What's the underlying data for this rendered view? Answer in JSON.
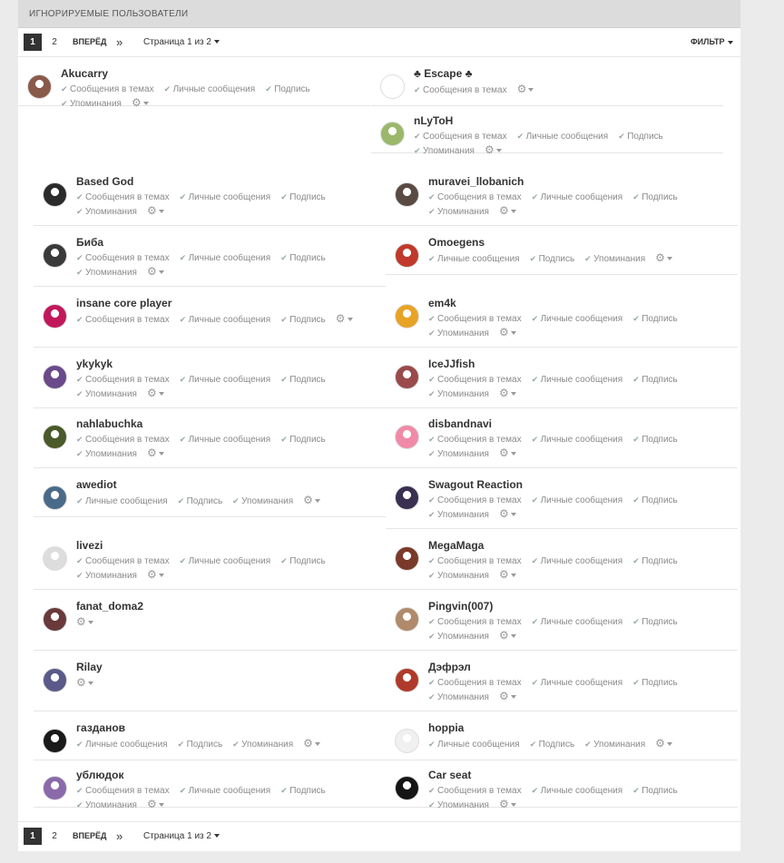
{
  "header": {
    "title": "ИГНОРИРУЕМЫЕ ПОЛЬЗОВАТЕЛИ"
  },
  "pagination": {
    "pages": [
      "1",
      "2"
    ],
    "next_label": "ВПЕРЁД",
    "last_icon": "»",
    "page_info": "Страница 1 из 2",
    "filter_label": "ФИЛЬТР"
  },
  "option_labels": {
    "topics": "Сообщения в темах",
    "pm": "Личные сообщения",
    "sig": "Подпись",
    "mentions": "Упоминания"
  },
  "users": [
    {
      "name": "Akucarry",
      "options": [
        "topics",
        "pm",
        "sig",
        "mentions"
      ],
      "avatar_color": "#8a5a4a"
    },
    {
      "name": "♣ Escape ♣",
      "options": [
        "topics"
      ],
      "avatar_color": "#ffffff"
    },
    {
      "name": "nLyToH",
      "options": [
        "topics",
        "pm",
        "sig",
        "mentions"
      ],
      "avatar_color": "#9bb86a"
    },
    {
      "name": "Based God",
      "options": [
        "topics",
        "pm",
        "sig",
        "mentions"
      ],
      "avatar_color": "#2b2b2b"
    },
    {
      "name": "muravei_llobanich",
      "options": [
        "topics",
        "pm",
        "sig",
        "mentions"
      ],
      "avatar_color": "#5a4a44"
    },
    {
      "name": "Биба",
      "options": [
        "topics",
        "pm",
        "sig",
        "mentions"
      ],
      "avatar_color": "#3a3a3a"
    },
    {
      "name": "Omoegens",
      "options": [
        "pm",
        "sig",
        "mentions"
      ],
      "avatar_color": "#c0392b"
    },
    {
      "name": "insane core player",
      "options": [
        "topics",
        "pm",
        "sig"
      ],
      "avatar_color": "#c2185b"
    },
    {
      "name": "em4k",
      "options": [
        "topics",
        "pm",
        "sig",
        "mentions"
      ],
      "avatar_color": "#e8a325"
    },
    {
      "name": "ykykyk",
      "options": [
        "topics",
        "pm",
        "sig",
        "mentions"
      ],
      "avatar_color": "#6a4a8a"
    },
    {
      "name": "IceJJfish",
      "options": [
        "topics",
        "pm",
        "sig",
        "mentions"
      ],
      "avatar_color": "#9a4a4a"
    },
    {
      "name": "nahlabuchka",
      "options": [
        "topics",
        "pm",
        "sig",
        "mentions"
      ],
      "avatar_color": "#4a5a2a"
    },
    {
      "name": "disbandnavi",
      "options": [
        "topics",
        "pm",
        "sig",
        "mentions"
      ],
      "avatar_color": "#f08aa8"
    },
    {
      "name": "awediot",
      "options": [
        "pm",
        "sig",
        "mentions"
      ],
      "avatar_color": "#4a6a8a"
    },
    {
      "name": "Swagout Reaction",
      "options": [
        "topics",
        "pm",
        "sig",
        "mentions"
      ],
      "avatar_color": "#3a3050"
    },
    {
      "name": "livezi",
      "options": [
        "topics",
        "pm",
        "sig",
        "mentions"
      ],
      "avatar_color": "#dddddd"
    },
    {
      "name": "MegaMaga",
      "options": [
        "topics",
        "pm",
        "sig",
        "mentions"
      ],
      "avatar_color": "#7a3a2a"
    },
    {
      "name": "fanat_doma2",
      "options": [],
      "avatar_color": "#6a3a3a"
    },
    {
      "name": "Pingvin(007)",
      "options": [
        "topics",
        "pm",
        "sig",
        "mentions"
      ],
      "avatar_color": "#b08a6a"
    },
    {
      "name": "Rilay",
      "options": [],
      "avatar_color": "#5a5a8a"
    },
    {
      "name": "Дэфрэл",
      "options": [
        "topics",
        "pm",
        "sig",
        "mentions"
      ],
      "avatar_color": "#b03a2a"
    },
    {
      "name": "газданов",
      "options": [
        "pm",
        "sig",
        "mentions"
      ],
      "avatar_color": "#1a1a1a"
    },
    {
      "name": "hoppia",
      "options": [
        "pm",
        "sig",
        "mentions"
      ],
      "avatar_color": "#f0f0f0"
    },
    {
      "name": "ублюдок",
      "options": [
        "topics",
        "pm",
        "sig",
        "mentions"
      ],
      "avatar_color": "#8a6aaa"
    },
    {
      "name": "Car seat",
      "options": [
        "topics",
        "pm",
        "sig",
        "mentions"
      ],
      "avatar_color": "#151515"
    }
  ]
}
